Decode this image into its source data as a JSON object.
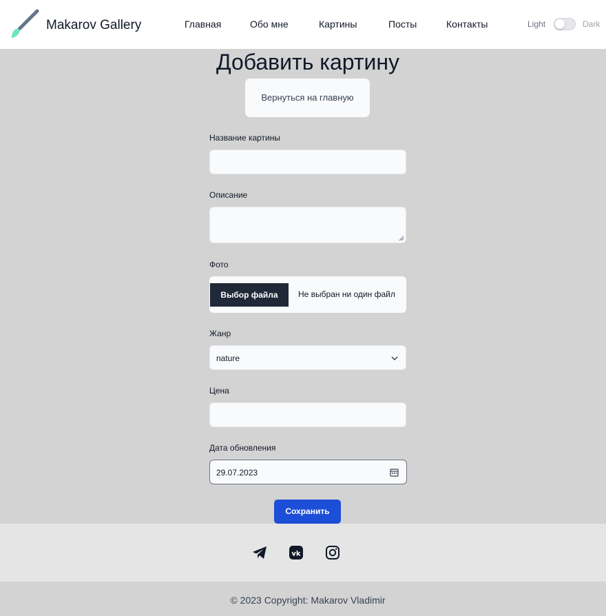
{
  "header": {
    "brand": "Makarov Gallery",
    "nav": [
      "Главная",
      "Обо мне",
      "Картины",
      "Посты",
      "Контакты"
    ],
    "theme": {
      "light_label": "Light",
      "dark_label": "Dark",
      "mode": "light"
    }
  },
  "main": {
    "title": "Добавить картину",
    "back_label": "Вернуться на главную",
    "fields": {
      "name_label": "Название картины",
      "name_value": "",
      "description_label": "Описание",
      "description_value": "",
      "photo_label": "Фото",
      "file_button": "Выбор файла",
      "file_status": "Не выбран ни один файл",
      "genre_label": "Жанр",
      "genre_value": "nature",
      "price_label": "Цена",
      "price_value": "",
      "date_label": "Дата обновления",
      "date_value": "29.07.2023"
    },
    "save_label": "Сохранить"
  },
  "footer": {
    "social": [
      "telegram-icon",
      "vk-icon",
      "instagram-icon"
    ],
    "copyright": "© 2023 Copyright: Makarov Vladimir"
  },
  "colors": {
    "page_bg": "#d3d3d3",
    "header_bg": "#ffffff",
    "primary": "#1d4ed8",
    "file_button_bg": "#1f2937",
    "brush_handle": "#64748b",
    "brush_tip": "#6ee7b7"
  }
}
